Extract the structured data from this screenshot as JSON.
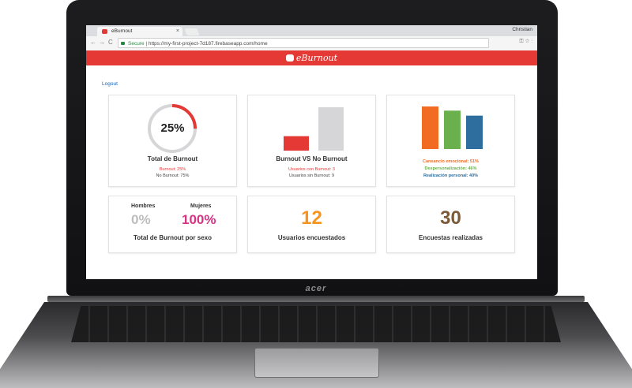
{
  "laptop": {
    "brand": "acer"
  },
  "browser": {
    "tab_title": "eBurnout",
    "tab_close": "×",
    "user_name": "Christian",
    "nav": {
      "back": "←",
      "forward": "→",
      "reload": "C"
    },
    "url_secure": "Secure",
    "url_separator": " | ",
    "url_text": "https://my-first-project-7d187.firebaseapp.com/home",
    "url_icons": "⚿ ☆ ⋮"
  },
  "app": {
    "title": "eBurnout",
    "logout": "Logout",
    "colors": {
      "brand": "#e53935",
      "gray": "#d6d6d8",
      "orange": "#f26b22",
      "green": "#6ab04c",
      "blue": "#2e6e9e",
      "pink": "#d63384",
      "count_orange": "#f7941d",
      "count_brown": "#7b5a3a"
    },
    "card_total": {
      "percent_label": "25%",
      "percent_value": 0.25,
      "title": "Total de Burnout",
      "line1": "Burnout: 25%",
      "line2": "No Burnout: 75%"
    },
    "card_vs": {
      "title": "Burnout VS No Burnout",
      "line1": "Usuarios con Burnout: 3",
      "line2": "Usuarios sin Burnout: 9",
      "values": {
        "burnout": 3,
        "no_burnout": 9
      }
    },
    "card_dims": {
      "line1": "Cansancio emocional: 51%",
      "line2": "Despersonalización: 46%",
      "line3": "Realización personal: 40%",
      "values": [
        51,
        46,
        40
      ]
    },
    "card_sex": {
      "label_h": "Hombres",
      "label_m": "Mujeres",
      "val_h": "0%",
      "val_m": "100%",
      "title": "Total de Burnout por sexo"
    },
    "card_users": {
      "value": "12",
      "label": "Usuarios encuestados"
    },
    "card_surveys": {
      "value": "30",
      "label": "Encuestas realizadas"
    }
  }
}
